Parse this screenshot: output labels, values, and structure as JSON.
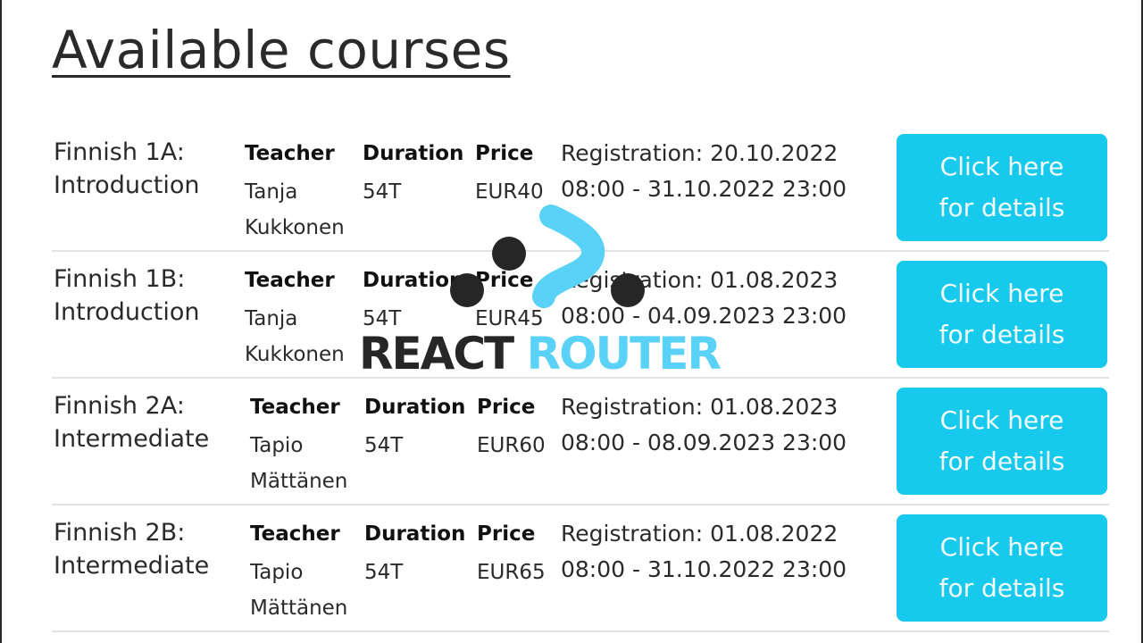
{
  "page": {
    "title": "Available courses"
  },
  "columns": {
    "teacher": "Teacher",
    "duration": "Duration",
    "price": "Price"
  },
  "courses": [
    {
      "name_line1": "Finnish 1A:",
      "name_line2": "Introduction",
      "teacher_first": "Tanja",
      "teacher_last": "Kukkonen",
      "duration": "54T",
      "price": "EUR40",
      "registration": "Registration: 20.10.2022 08:00 - 31.10.2022 23:00",
      "button_line1": "Click here",
      "button_line2": "for details"
    },
    {
      "name_line1": "Finnish 1B:",
      "name_line2": "Introduction",
      "teacher_first": "Tanja",
      "teacher_last": "Kukkonen",
      "duration": "54T",
      "price": "EUR45",
      "registration": "Registration: 01.08.2023 08:00 - 04.09.2023 23:00",
      "button_line1": "Click here",
      "button_line2": "for details"
    },
    {
      "name_line1": "Finnish 2A:",
      "name_line2": "Intermediate",
      "teacher_first": "Tapio",
      "teacher_last": "Mättänen",
      "duration": "54T",
      "price": "EUR60",
      "registration": "Registration: 01.08.2023 08:00 - 08.09.2023 23:00",
      "button_line1": "Click here",
      "button_line2": "for details"
    },
    {
      "name_line1": "Finnish 2B:",
      "name_line2": "Intermediate",
      "teacher_first": "Tapio",
      "teacher_last": "Mättänen",
      "duration": "54T",
      "price": "EUR65",
      "registration": "Registration: 01.08.2022 08:00 - 31.10.2022 23:00",
      "button_line1": "Click here",
      "button_line2": "for details"
    }
  ],
  "logo": {
    "icon": "react-router-logo-icon",
    "word1": "REACT",
    "word2": "ROUTER",
    "color_dark": "#262626",
    "color_accent": "#5ad2f7"
  },
  "colors": {
    "button_bg": "#17c9ec",
    "button_text": "#f3fbfe"
  }
}
